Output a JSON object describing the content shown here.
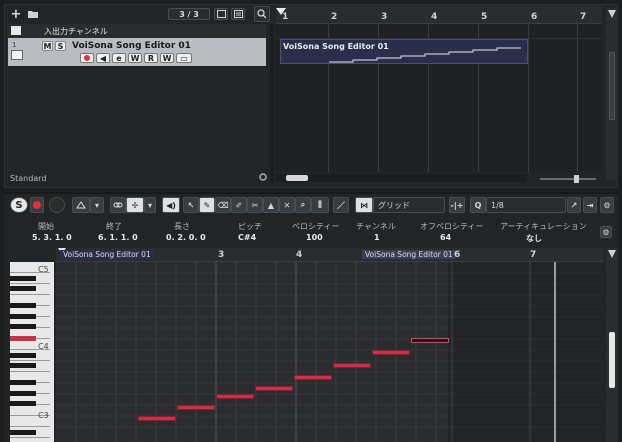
{
  "project": {
    "track_count": "3 / 3",
    "folder_name": "入出力チャンネル",
    "track_number": "1",
    "track_name": "VoiSona Song Editor 01",
    "track_buttons": [
      "M",
      "S"
    ],
    "track_tools": [
      "●",
      "◀",
      "e",
      "W",
      "R",
      "W",
      "▭"
    ],
    "preset_label": "Standard",
    "bar_numbers": [
      "1",
      "2",
      "3",
      "4",
      "5",
      "6",
      "7"
    ],
    "event_name": "VoiSona Song Editor 01"
  },
  "editor": {
    "snap_label": "グリッド",
    "quantize_value": "1/8",
    "info_headers": [
      "開始",
      "終了",
      "長さ",
      "ピッチ",
      "ベロシティー",
      "チャンネル",
      "オフベロシティー",
      "アーティキュレーション"
    ],
    "info_values": [
      "5. 3. 1.   0",
      "6. 1. 1.   0",
      "0. 2. 0.   0",
      "C#4",
      "100",
      "1",
      "64",
      "なし"
    ],
    "ruler_numbers": [
      "3",
      "4",
      "6",
      "7"
    ],
    "event_tags": [
      "VoiSona Song Editor 01",
      "VoiSona Song Editor 01"
    ],
    "key_labels": [
      "C5",
      "C4",
      "C3"
    ]
  },
  "colors": {
    "note": "#c8334a",
    "selected_note_outline": "#d24a5a",
    "event_fill": "#2b2e4a",
    "record": "#e0303a"
  }
}
